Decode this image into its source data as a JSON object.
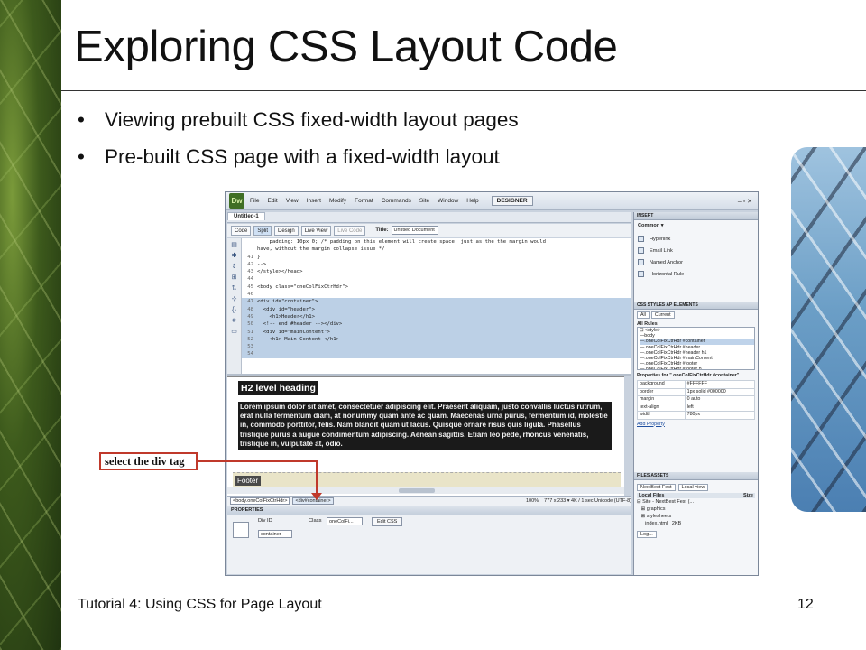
{
  "slide": {
    "title": "Exploring CSS Layout Code",
    "bullets": [
      "Viewing prebuilt CSS fixed-width layout pages",
      "Pre-built CSS page with a fixed-width layout"
    ],
    "footer_left": "Tutorial 4: Using CSS for Page Layout",
    "page_number": "12",
    "callout": "select the div tag"
  },
  "app": {
    "logo": "Dw",
    "menu": [
      "File",
      "Edit",
      "View",
      "Insert",
      "Modify",
      "Format",
      "Commands",
      "Site",
      "Window",
      "Help"
    ],
    "workspace": "DESIGNER",
    "window_controls": "‒ ▫ ✕",
    "doc_tab": "Untitled-1",
    "toolbar": {
      "code": "Code",
      "split": "Split",
      "design": "Design",
      "live_view": "Live View",
      "live_code": "Live Code",
      "title_label": "Title:",
      "title_value": "Untitled Document"
    },
    "code_lines": [
      {
        "n": "",
        "t": "    padding: 10px 0; /* padding on this element will create space, just as the the margin would",
        "hl": false
      },
      {
        "n": "",
        "t": "have, without the margin collapse issue */",
        "hl": false
      },
      {
        "n": "41",
        "t": "}",
        "hl": false
      },
      {
        "n": "42",
        "t": "-->",
        "hl": false
      },
      {
        "n": "43",
        "t": "</style></head>",
        "hl": false
      },
      {
        "n": "44",
        "t": "",
        "hl": false
      },
      {
        "n": "45",
        "t": "<body class=\"oneColFixCtrHdr\">",
        "hl": false
      },
      {
        "n": "46",
        "t": "",
        "hl": false
      },
      {
        "n": "47",
        "t": "<div id=\"container\">",
        "hl": true
      },
      {
        "n": "48",
        "t": "  <div id=\"header\">",
        "hl": true
      },
      {
        "n": "49",
        "t": "    <h1>Header</h1>",
        "hl": true
      },
      {
        "n": "50",
        "t": "  <!-- end #header --></div>",
        "hl": true
      },
      {
        "n": "51",
        "t": "  <div id=\"mainContent\">",
        "hl": true
      },
      {
        "n": "52",
        "t": "    <h1> Main Content </h1>",
        "hl": true
      },
      {
        "n": "53",
        "t": "",
        "hl": true
      },
      {
        "n": "54",
        "t": "",
        "hl": true
      }
    ],
    "design_view": {
      "h2": "H2 level heading",
      "lorem": "Lorem ipsum dolor sit amet, consectetuer adipiscing elit. Praesent aliquam, justo convallis luctus rutrum, erat nulla fermentum diam, at nonummy quam ante ac quam. Maecenas urna purus, fermentum id, molestie in, commodo porttitor, felis. Nam blandit quam ut lacus. Quisque ornare risus quis ligula. Phasellus tristique purus a augue condimentum adipiscing. Aenean sagittis. Etiam leo pede, rhoncus venenatis, tristique in, vulputate at, odio.",
      "footer": "Footer"
    },
    "status": {
      "tag1": "<body.oneColFixCtrHdr>",
      "tag2": "<div#container>",
      "zoom": "100%",
      "info": "777 x 233 ▾ 4K / 1 sec  Unicode (UTF-8)"
    },
    "properties": {
      "header": "PROPERTIES",
      "div_id_label": "Div ID",
      "div_id_value": "container",
      "class_label": "Class",
      "class_value": "oneColFi...",
      "edit_css": "Edit CSS"
    },
    "insert_panel": {
      "header": "INSERT",
      "category": "Common ▾",
      "items": [
        "Hyperlink",
        "Email Link",
        "Named Anchor",
        "Horizontal Rule"
      ]
    },
    "css_panel": {
      "header": "CSS STYLES   AP ELEMENTS",
      "tab_all": "All",
      "tab_current": "Current",
      "all_rules": "All Rules",
      "rules": [
        "⊟ <style>",
        "   —body",
        "   —.oneColFixCtrHdr #container",
        "   —.oneColFixCtrHdr #header",
        "   —.oneColFixCtrHdr #header h1",
        "   —.oneColFixCtrHdr #mainContent",
        "   —.oneColFixCtrHdr #footer",
        "   —.oneColFixCtrHdr #footer p"
      ],
      "props_for": "Properties for \".oneColFixCtrHdr #container\"",
      "props": [
        {
          "k": "background",
          "v": "#FFFFFF"
        },
        {
          "k": "border",
          "v": "1px solid #000000"
        },
        {
          "k": "margin",
          "v": "0 auto"
        },
        {
          "k": "text-align",
          "v": "left"
        },
        {
          "k": "width",
          "v": "780px"
        }
      ],
      "add_property": "Add Property"
    },
    "files_panel": {
      "header": "FILES   ASSETS",
      "site": "NextBest Fest",
      "view": "Local view",
      "local_files": "Local Files",
      "size_col": "Size",
      "tree": [
        "⊟ Site - NextBest Fest (...",
        "   ⊞ graphics",
        "   ⊞ stylesheets",
        "      index.html   2KB"
      ],
      "log_btn": "Log..."
    }
  }
}
